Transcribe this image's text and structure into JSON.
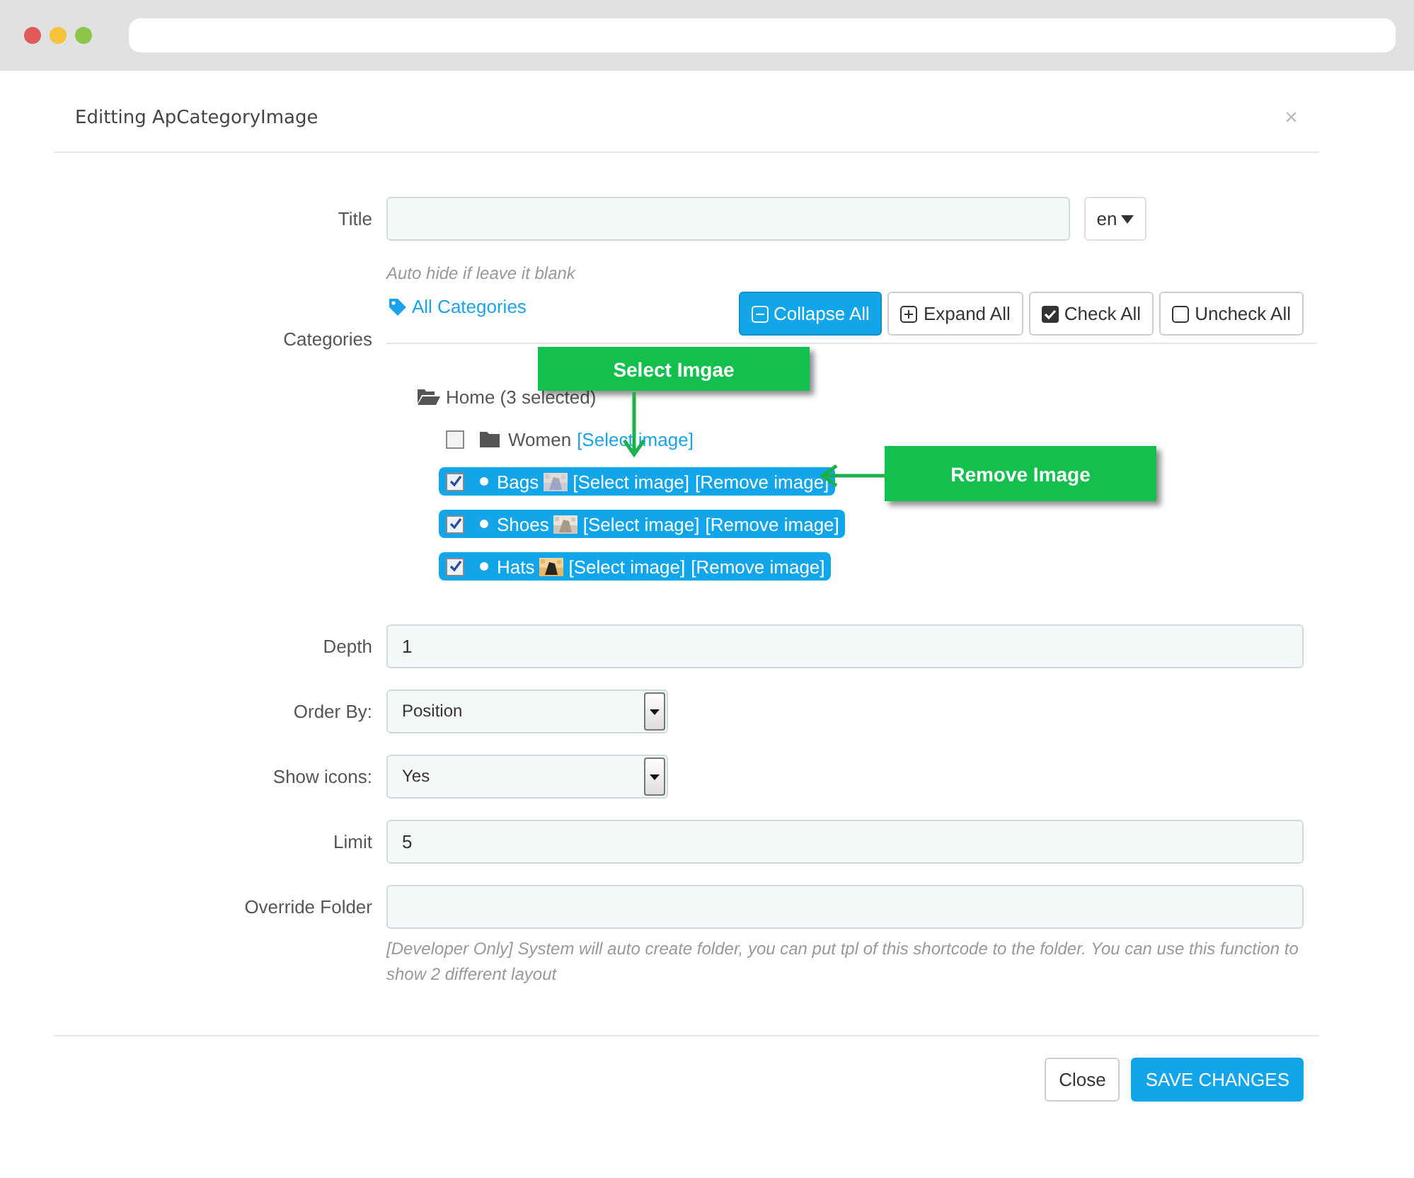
{
  "dialog": {
    "title": "Editting ApCategoryImage",
    "close": "×"
  },
  "title_field": {
    "label": "Title",
    "language": "en",
    "help": "Auto hide if leave it blank"
  },
  "categories": {
    "label": "Categories",
    "link": "All Categories",
    "buttons": [
      {
        "kind": "collapse",
        "label": "Collapse All",
        "selected": true
      },
      {
        "kind": "expand",
        "label": "Expand All",
        "selected": false
      },
      {
        "kind": "check",
        "label": "Check All",
        "selected": false
      },
      {
        "kind": "uncheck",
        "label": "Uncheck All",
        "selected": false
      }
    ],
    "tree": {
      "label": "Home (3 selected)",
      "children": [
        {
          "kind": "folder",
          "label": "Women",
          "checked": false,
          "links": [
            "[Select image]"
          ]
        },
        {
          "kind": "leaf",
          "label": "Bags",
          "checked": true,
          "links": [
            "[Select image]",
            "[Remove image]"
          ]
        },
        {
          "kind": "leaf",
          "label": "Shoes",
          "checked": true,
          "links": [
            "[Select image]",
            "[Remove image]"
          ]
        },
        {
          "kind": "leaf",
          "label": "Hats",
          "checked": true,
          "links": [
            "[Select image]",
            "[Remove image]"
          ]
        }
      ]
    }
  },
  "fields": [
    {
      "kind": "text",
      "label": "Depth",
      "value": "1"
    },
    {
      "kind": "select",
      "label": "Order By:",
      "value": "Position"
    },
    {
      "kind": "select",
      "label": "Show icons:",
      "value": "Yes"
    },
    {
      "kind": "text",
      "label": "Limit",
      "value": "5"
    },
    {
      "kind": "text",
      "label": "Override Folder",
      "help": "[Developer Only] System will auto create folder, you can put tpl of this shortcode to the folder. You can use this function to show 2 different layout"
    }
  ],
  "footer": {
    "buttons": [
      {
        "kind": "default",
        "label": "Close"
      },
      {
        "kind": "primary",
        "label": "SAVE CHANGES"
      }
    ]
  },
  "callouts": [
    {
      "kind": "down",
      "label": "Select Imgae"
    },
    {
      "kind": "left",
      "label": "Remove Image"
    }
  ]
}
